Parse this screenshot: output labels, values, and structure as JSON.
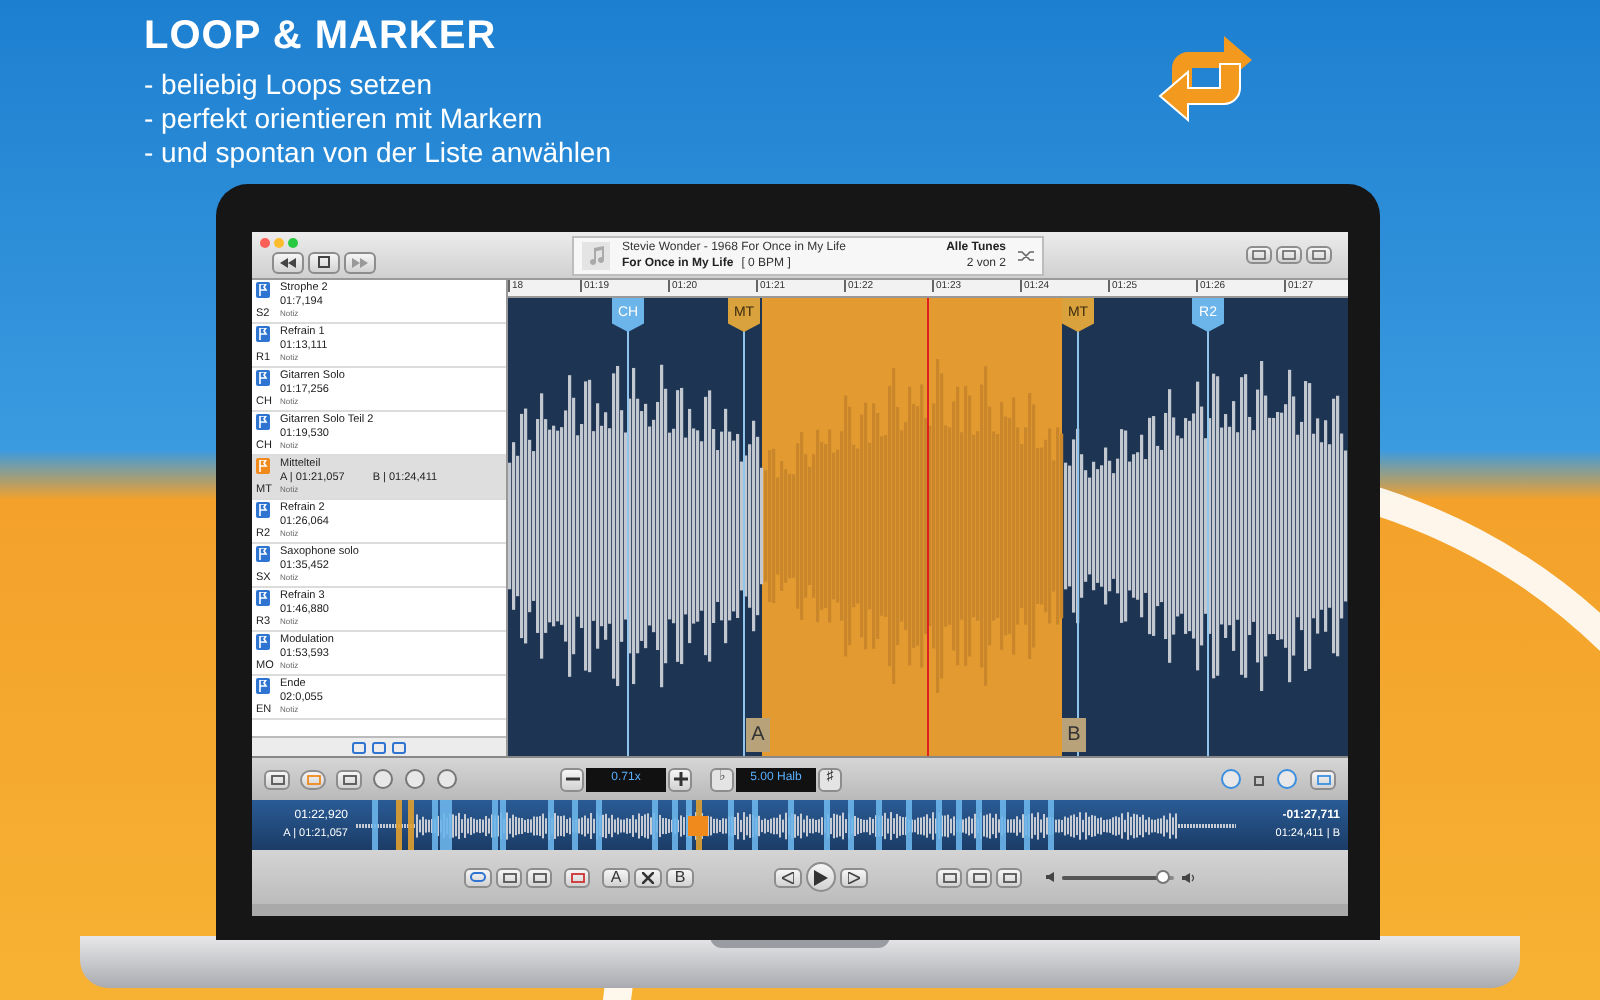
{
  "headline": "LOOP & MARKER",
  "bullets": [
    "- beliebig Loops setzen",
    "- perfekt orientieren mit Markern",
    "- und spontan von der Liste anwählen"
  ],
  "app": {
    "now_playing": {
      "artist_line": "Stevie Wonder - 1968 For Once in My Life",
      "title": "For Once in My Life",
      "bpm": "[ 0 BPM ]",
      "playlist": "Alle Tunes",
      "position": "2 von 2"
    },
    "markers_list": [
      {
        "kind": "marker",
        "code": "S2",
        "name": "Strophe 2",
        "time": "01:7,194",
        "note": "Notiz",
        "selected": false
      },
      {
        "kind": "marker",
        "code": "R1",
        "name": "Refrain 1",
        "time": "01:13,111",
        "note": "Notiz",
        "selected": false
      },
      {
        "kind": "marker",
        "code": "CH",
        "name": "Gitarren Solo",
        "time": "01:17,256",
        "note": "Notiz",
        "selected": false
      },
      {
        "kind": "marker",
        "code": "CH",
        "name": "Gitarren Solo Teil 2",
        "time": "01:19,530",
        "note": "Notiz",
        "selected": false
      },
      {
        "kind": "loop",
        "code": "MT",
        "name": "Mittelteil",
        "start": "A | 01:21,057",
        "end": "B | 01:24,411",
        "note": "Notiz",
        "selected": true
      },
      {
        "kind": "marker",
        "code": "R2",
        "name": "Refrain 2",
        "time": "01:26,064",
        "note": "Notiz",
        "selected": false
      },
      {
        "kind": "marker",
        "code": "SX",
        "name": "Saxophone solo",
        "time": "01:35,452",
        "note": "Notiz",
        "selected": false
      },
      {
        "kind": "marker",
        "code": "R3",
        "name": "Refrain 3",
        "time": "01:46,880",
        "note": "Notiz",
        "selected": false
      },
      {
        "kind": "marker",
        "code": "MO",
        "name": "Modulation",
        "time": "01:53,593",
        "note": "Notiz",
        "selected": false
      },
      {
        "kind": "marker",
        "code": "EN",
        "name": "Ende",
        "time": "02:0,055",
        "note": "Notiz",
        "selected": false
      }
    ],
    "ruler": [
      "18",
      "01:19",
      "01:20",
      "01:21",
      "01:22",
      "01:23",
      "01:24",
      "01:25",
      "01:26",
      "01:27"
    ],
    "flags": [
      {
        "label": "CH",
        "kind": "marker"
      },
      {
        "label": "MT",
        "kind": "loop"
      },
      {
        "label": "MT",
        "kind": "loop"
      },
      {
        "label": "R2",
        "kind": "marker"
      }
    ],
    "loop_points": [
      "A",
      "B"
    ],
    "speed": "0.71x",
    "flat_symbol": "♭",
    "pitch": "5.00 Halb",
    "sharp_symbol": "♯",
    "overview": {
      "elapsed": "01:22,920",
      "loop_start": "A | 01:21,057",
      "remaining": "-01:27,711",
      "loop_end": "01:24,411 | B"
    },
    "transport": {
      "loop_on": true,
      "point_a": "A",
      "point_b": "B",
      "volume": {
        "level": 0.9
      }
    }
  }
}
